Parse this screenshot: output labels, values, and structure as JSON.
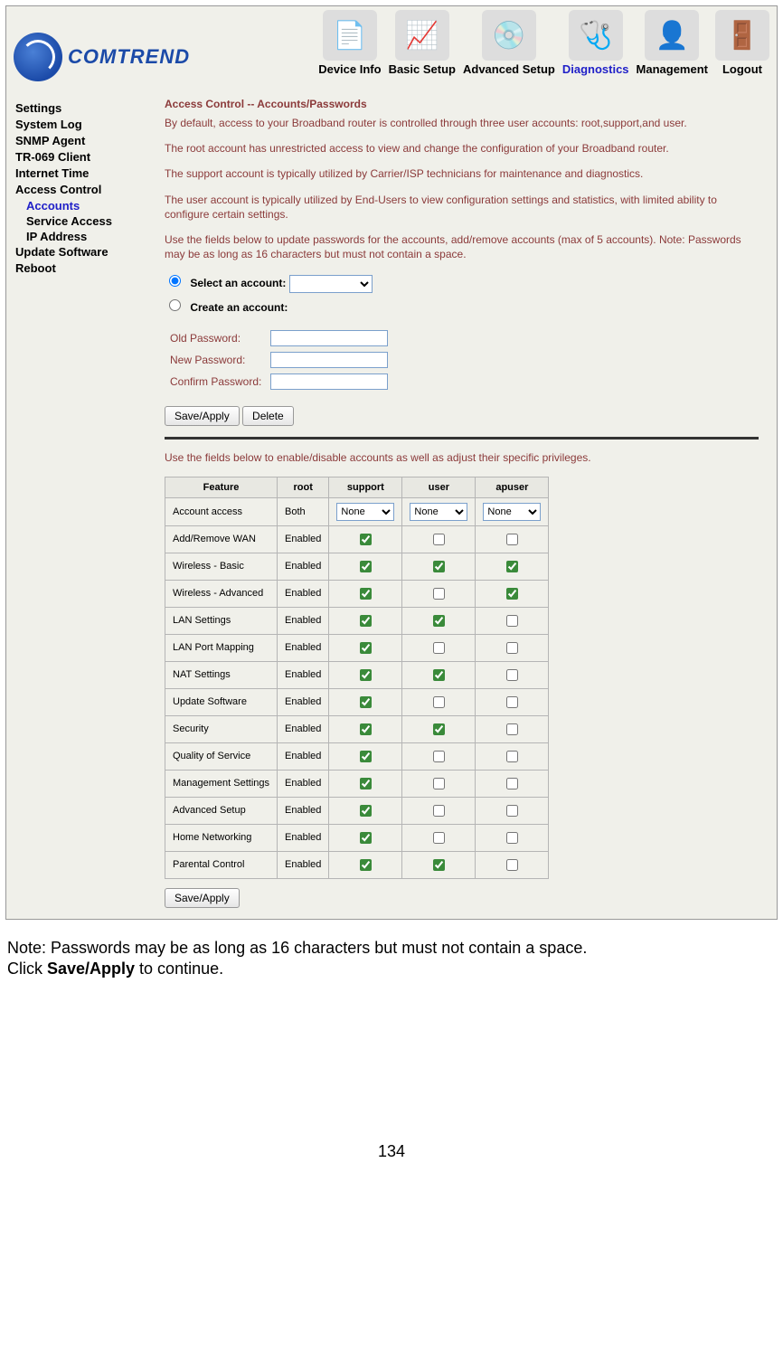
{
  "logo": {
    "text": "COMTREND"
  },
  "nav": [
    {
      "label": "Device Info",
      "glyph": "📄"
    },
    {
      "label": "Basic Setup",
      "glyph": "📈"
    },
    {
      "label": "Advanced Setup",
      "glyph": "💿"
    },
    {
      "label": "Diagnostics",
      "glyph": "🩺",
      "active": true
    },
    {
      "label": "Management",
      "glyph": "👤"
    },
    {
      "label": "Logout",
      "glyph": "🚪"
    }
  ],
  "sidebar": {
    "items": [
      "Settings",
      "System Log",
      "SNMP Agent",
      "TR-069 Client",
      "Internet Time",
      "Access Control"
    ],
    "sub_items": [
      {
        "label": "Accounts",
        "active": true
      },
      {
        "label": "Service Access"
      },
      {
        "label": "IP Address"
      }
    ],
    "items_after": [
      "Update Software",
      "Reboot"
    ]
  },
  "content": {
    "title": "Access Control -- Accounts/Passwords",
    "p1": "By default, access to your Broadband router is controlled through three user accounts: root,support,and user.",
    "p2": "The root account has unrestricted access to view and change the configuration of your Broadband router.",
    "p3": "The support account is typically utilized by Carrier/ISP technicians for maintenance and diagnostics.",
    "p4": "The user account is typically utilized by End-Users to view configuration settings and statistics, with limited ability to configure certain settings.",
    "p5": "Use the fields below to update passwords for the accounts, add/remove accounts (max of 5 accounts). Note: Passwords may be as long as 16 characters but must not contain a space.",
    "radio_select_label": "Select an account:",
    "radio_create_label": "Create an account:",
    "old_pw_label": "Old Password:",
    "new_pw_label": "New Password:",
    "confirm_pw_label": "Confirm Password:",
    "save_apply_label": "Save/Apply",
    "delete_label": "Delete",
    "p6": "Use the fields below to enable/disable accounts as well as adjust their specific privileges.",
    "save_apply2_label": "Save/Apply"
  },
  "priv_table": {
    "headers": [
      "Feature",
      "root",
      "support",
      "user",
      "apuser"
    ],
    "account_access_row": {
      "feature": "Account access",
      "root": "Both",
      "select_value": "None"
    },
    "rows": [
      {
        "feature": "Add/Remove WAN",
        "root": "Enabled",
        "support": true,
        "user": false,
        "apuser": false
      },
      {
        "feature": "Wireless - Basic",
        "root": "Enabled",
        "support": true,
        "user": true,
        "apuser": true
      },
      {
        "feature": "Wireless - Advanced",
        "root": "Enabled",
        "support": true,
        "user": false,
        "apuser": true
      },
      {
        "feature": "LAN Settings",
        "root": "Enabled",
        "support": true,
        "user": true,
        "apuser": false
      },
      {
        "feature": "LAN Port Mapping",
        "root": "Enabled",
        "support": true,
        "user": false,
        "apuser": false
      },
      {
        "feature": "NAT Settings",
        "root": "Enabled",
        "support": true,
        "user": true,
        "apuser": false
      },
      {
        "feature": "Update Software",
        "root": "Enabled",
        "support": true,
        "user": false,
        "apuser": false
      },
      {
        "feature": "Security",
        "root": "Enabled",
        "support": true,
        "user": true,
        "apuser": false
      },
      {
        "feature": "Quality of Service",
        "root": "Enabled",
        "support": true,
        "user": false,
        "apuser": false
      },
      {
        "feature": "Management Settings",
        "root": "Enabled",
        "support": true,
        "user": false,
        "apuser": false
      },
      {
        "feature": "Advanced Setup",
        "root": "Enabled",
        "support": true,
        "user": false,
        "apuser": false
      },
      {
        "feature": "Home Networking",
        "root": "Enabled",
        "support": true,
        "user": false,
        "apuser": false
      },
      {
        "feature": "Parental Control",
        "root": "Enabled",
        "support": true,
        "user": true,
        "apuser": false
      }
    ]
  },
  "footnote": {
    "line1_a": "Note: Passwords may be as long as 16 characters but must not contain a space.",
    "line2_a": "Click ",
    "line2_bold": "Save/Apply",
    "line2_b": " to continue."
  },
  "page_number": "134"
}
